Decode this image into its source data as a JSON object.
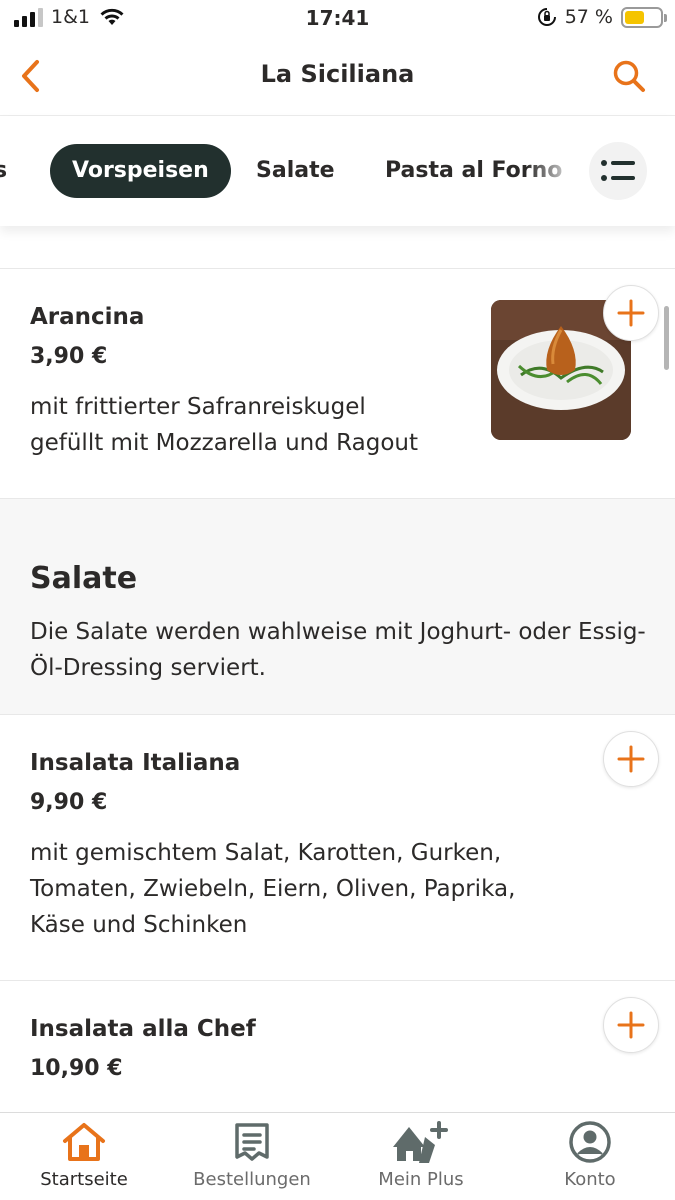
{
  "status_bar": {
    "carrier": "1&1",
    "time": "17:41",
    "battery_percent": "57 %"
  },
  "header": {
    "title": "La Siciliana"
  },
  "categories": {
    "items": [
      {
        "label": "s"
      },
      {
        "label": "Vorspeisen"
      },
      {
        "label": "Salate"
      },
      {
        "label": "Pasta al Forno"
      }
    ],
    "active": "Vorspeisen"
  },
  "menu": {
    "arancina": {
      "name": "Arancina",
      "price": "3,90 €",
      "description_lines": [
        "mit frittierter Safranreiskugel",
        "gefüllt mit Mozzarella und Ragout"
      ]
    },
    "salate_section": {
      "title": "Salate",
      "description": "Die Salate werden wahlweise mit Joghurt- oder Essig-Öl-Dressing serviert."
    },
    "insalata_italiana": {
      "name": "Insalata Italiana",
      "price": "9,90 €",
      "description_lines": [
        "mit gemischtem Salat, Karotten, Gurken,",
        "Tomaten, Zwiebeln, Eiern, Oliven, Paprika,",
        "Käse und Schinken"
      ]
    },
    "insalata_chef": {
      "name": "Insalata alla Chef",
      "price": "10,90 €"
    }
  },
  "tabbar": {
    "tabs": [
      {
        "label": "Startseite",
        "icon": "home-icon"
      },
      {
        "label": "Bestellungen",
        "icon": "receipt-icon"
      },
      {
        "label": "Mein Plus",
        "icon": "plus-membership-icon"
      },
      {
        "label": "Konto",
        "icon": "account-icon"
      }
    ],
    "active": "Startseite"
  },
  "colors": {
    "accent": "#e8731a",
    "active_chip": "#22302e",
    "text": "#2c2a29"
  }
}
